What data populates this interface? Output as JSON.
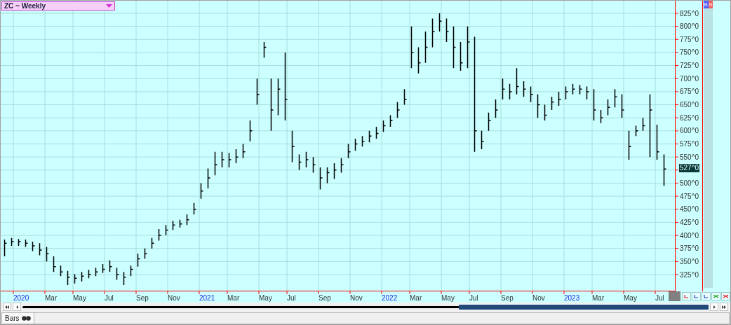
{
  "chart": {
    "title": "ZC ~ Weekly",
    "last_price": "527^0",
    "price_labels": [
      "825^0",
      "800^0",
      "775^0",
      "750^0",
      "725^0",
      "700^0",
      "675^0",
      "650^0",
      "625^0",
      "600^0",
      "575^0",
      "550^0",
      "500^0",
      "475^0",
      "450^0",
      "425^0",
      "400^0",
      "375^0",
      "350^0",
      "325^0"
    ],
    "date_labels": [
      {
        "label": "2020",
        "highlighted": true
      },
      {
        "label": "Mar",
        "highlighted": false
      },
      {
        "label": "May",
        "highlighted": false
      },
      {
        "label": "Jul",
        "highlighted": false
      },
      {
        "label": "Sep",
        "highlighted": false
      },
      {
        "label": "Nov",
        "highlighted": false
      },
      {
        "label": "2021",
        "highlighted": true
      },
      {
        "label": "Mar",
        "highlighted": false
      },
      {
        "label": "May",
        "highlighted": false
      },
      {
        "label": "Jul",
        "highlighted": false
      },
      {
        "label": "Sep",
        "highlighted": false
      },
      {
        "label": "Nov",
        "highlighted": false
      },
      {
        "label": "2022",
        "highlighted": true
      },
      {
        "label": "Mar",
        "highlighted": false
      },
      {
        "label": "May",
        "highlighted": false
      },
      {
        "label": "Jul",
        "highlighted": false
      },
      {
        "label": "Sep",
        "highlighted": false
      },
      {
        "label": "Nov",
        "highlighted": false
      },
      {
        "label": "2023",
        "highlighted": true
      },
      {
        "label": "Mar",
        "highlighted": false
      },
      {
        "label": "May",
        "highlighted": false
      },
      {
        "label": "Jul",
        "highlighted": false
      }
    ]
  },
  "side_buttons": [
    "B",
    "S"
  ],
  "status_bar": {
    "tab": "Bars"
  }
}
